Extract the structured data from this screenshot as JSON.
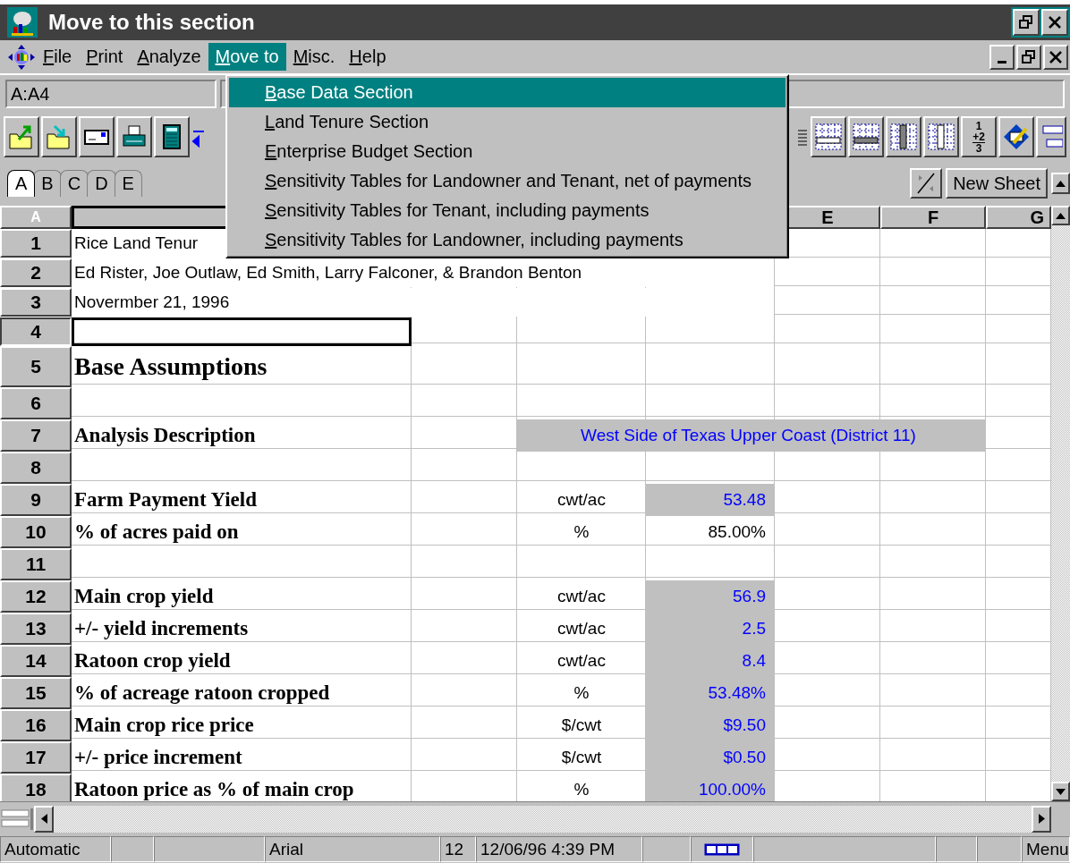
{
  "window": {
    "title": "Move to this section"
  },
  "menu_bar": [
    {
      "label": "File",
      "selected": false
    },
    {
      "label": "Print",
      "selected": false
    },
    {
      "label": "Analyze",
      "selected": false
    },
    {
      "label": "Move to",
      "selected": true
    },
    {
      "label": "Misc.",
      "selected": false
    },
    {
      "label": "Help",
      "selected": false
    }
  ],
  "name_box": {
    "value": "A:A4"
  },
  "dropdown": {
    "items": [
      {
        "label": "Base Data Section",
        "selected": true
      },
      {
        "label": "Land Tenure Section",
        "selected": false
      },
      {
        "label": "Enterprise Budget Section",
        "selected": false
      },
      {
        "label": "Sensitivity Tables for Landowner and Tenant, net of payments",
        "selected": false
      },
      {
        "label": "Sensitivity Tables for Tenant, including payments",
        "selected": false
      },
      {
        "label": "Sensitivity Tables for Landowner, including payments",
        "selected": false
      }
    ]
  },
  "toolbar": {
    "fraction": [
      "1",
      "+2",
      "3"
    ]
  },
  "sheet_tabs": [
    {
      "label": "A",
      "selected": true
    },
    {
      "label": "B",
      "selected": false
    },
    {
      "label": "C",
      "selected": false
    },
    {
      "label": "D",
      "selected": false
    },
    {
      "label": "E",
      "selected": false
    }
  ],
  "new_sheet_button": "New Sheet",
  "grid": {
    "corner": "A",
    "column_headers": [
      "E",
      "F",
      "G"
    ]
  },
  "rows": [
    {
      "number": "1",
      "kind": "title",
      "text": "Rice Land Tenur",
      "selected": false
    },
    {
      "number": "2",
      "kind": "title",
      "text": "Ed Rister, Joe Outlaw, Ed Smith, Larry Falconer, & Brandon Benton",
      "selected": false
    },
    {
      "number": "3",
      "kind": "title",
      "text": "Novermber 21, 1996",
      "selected": false
    },
    {
      "number": "4",
      "kind": "blank",
      "selected": true
    },
    {
      "number": "5",
      "kind": "heading",
      "text": "Base Assumptions",
      "selected": false
    },
    {
      "number": "6",
      "kind": "blank",
      "selected": false
    },
    {
      "number": "7",
      "kind": "description",
      "text": "Analysis Description",
      "value": "West Side of Texas Upper Coast (District 11)",
      "input": true,
      "selected": false
    },
    {
      "number": "8",
      "kind": "blank",
      "selected": false
    },
    {
      "number": "9",
      "kind": "item",
      "text": "Farm Payment Yield",
      "unit": "cwt/ac",
      "value": "53.48",
      "input": true,
      "selected": false
    },
    {
      "number": "10",
      "kind": "item",
      "text": "% of acres paid on",
      "unit": "%",
      "value": "85.00%",
      "input": false,
      "selected": false
    },
    {
      "number": "11",
      "kind": "blank",
      "selected": false
    },
    {
      "number": "12",
      "kind": "item",
      "text": "Main crop yield",
      "unit": "cwt/ac",
      "value": "56.9",
      "input": true,
      "selected": false
    },
    {
      "number": "13",
      "kind": "item",
      "text": "+/- yield increments",
      "unit": "cwt/ac",
      "value": "2.5",
      "input": true,
      "selected": false
    },
    {
      "number": "14",
      "kind": "item",
      "text": "Ratoon crop yield",
      "unit": "cwt/ac",
      "value": "8.4",
      "input": true,
      "selected": false
    },
    {
      "number": "15",
      "kind": "item",
      "text": "% of acreage ratoon cropped",
      "unit": "%",
      "value": "53.48%",
      "input": true,
      "selected": false
    },
    {
      "number": "16",
      "kind": "item",
      "text": "Main crop rice price",
      "unit": "$/cwt",
      "value": "$9.50",
      "input": true,
      "selected": false
    },
    {
      "number": "17",
      "kind": "item",
      "text": "+/- price increment",
      "unit": "$/cwt",
      "value": "$0.50",
      "input": true,
      "selected": false
    },
    {
      "number": "18",
      "kind": "item",
      "text": "Ratoon price as % of main crop",
      "unit": "%",
      "value": "100.00%",
      "input": true,
      "selected": false
    }
  ],
  "status_bar": {
    "mode": "Automatic",
    "font": "Arial",
    "size": "12",
    "datetime": "12/06/96  4:39 PM",
    "menu": "Menu"
  }
}
